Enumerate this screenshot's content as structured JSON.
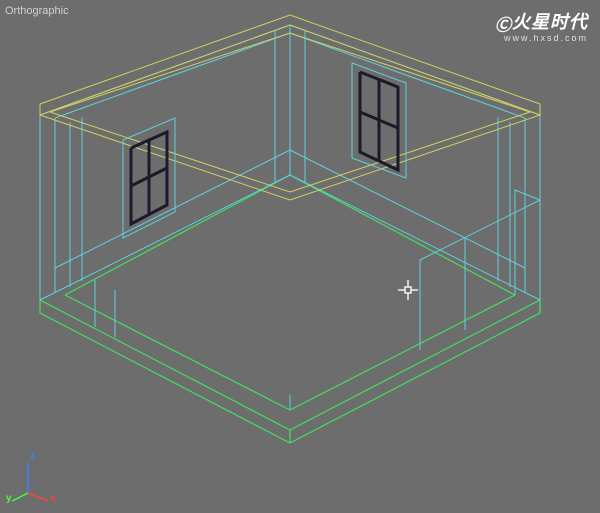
{
  "viewport": {
    "projection_label": "Orthographic"
  },
  "watermark": {
    "logo_text": "火星时代",
    "url": "www.hxsd.com"
  },
  "axis": {
    "x_label": "x",
    "y_label": "y",
    "z_label": "z"
  },
  "scene": {
    "description": "Isometric wireframe view of a room interior with two windows, walls, floor and ceiling structure",
    "colors": {
      "floor_outline": "#40e060",
      "wall_wireframe": "#60d0e0",
      "ceiling_wireframe": "#d0d060",
      "window_frame": "#1a1a2a"
    }
  }
}
